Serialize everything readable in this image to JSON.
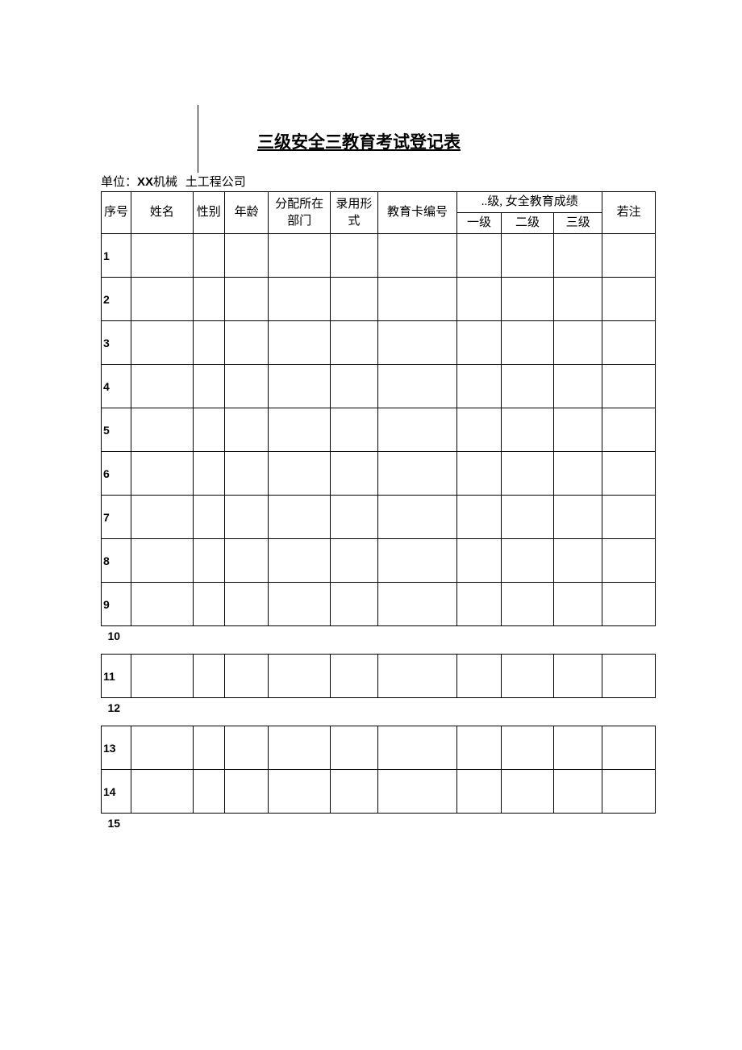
{
  "title": "三级安全三教育考试登记表",
  "unit_line": {
    "prefix": "单位：",
    "bold": "XX",
    "mid": "机械",
    "suffix": "土工程公司"
  },
  "headers": {
    "seq": "序号",
    "name": "姓名",
    "sex": "性别",
    "age": "年龄",
    "dept_l1": "分配所在",
    "dept_l2": "部门",
    "hire_l1": "录用形",
    "hire_l2": "式",
    "card": "教育卡编号",
    "grade_group": "..级, 女全教育成绩",
    "level1": "一级",
    "level2": "二级",
    "level3": "三级",
    "note": "若注"
  },
  "rows": [
    "1",
    "2",
    "3",
    "4",
    "5",
    "6",
    "7",
    "8",
    "9"
  ],
  "gap10": "10",
  "row11": "11",
  "gap12": "12",
  "row13": "13",
  "row14": "14",
  "gap15": "15"
}
